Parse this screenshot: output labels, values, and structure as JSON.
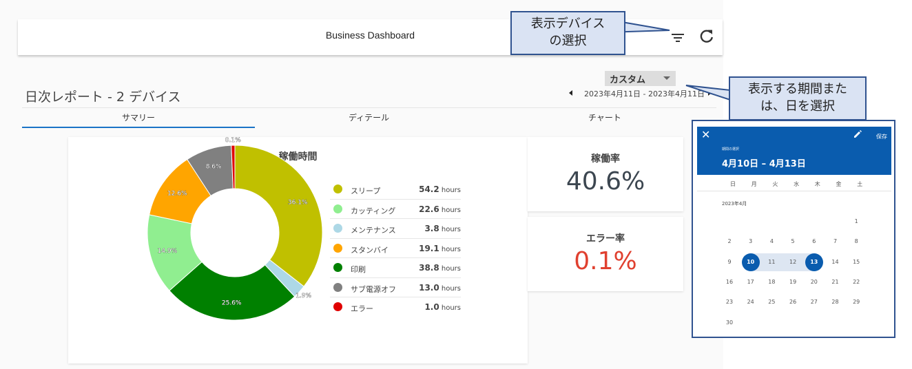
{
  "header": {
    "title": "Business Dashboard",
    "filter_icon": "filter-list-icon",
    "refresh_icon": "refresh-icon"
  },
  "report": {
    "title": "日次レポート - 2 デバイス",
    "range_mode": "カスタム",
    "date_range": "2023年4月11日 - 2023年4月11日"
  },
  "tabs": [
    {
      "label": "サマリー",
      "active": true
    },
    {
      "label": "ディテール",
      "active": false
    },
    {
      "label": "チャート",
      "active": false
    }
  ],
  "pie_card": {
    "title": "稼働時間",
    "unit": "hours"
  },
  "chart_data": {
    "type": "pie",
    "title": "稼働時間",
    "donut": true,
    "unit": "hours",
    "series": [
      {
        "name": "スリープ",
        "value": 54.2,
        "percent_label": "36.1%",
        "color": "#c0c000"
      },
      {
        "name": "カッティング",
        "value": 22.6,
        "percent_label": "14.9%",
        "color": "#90ee90"
      },
      {
        "name": "メンテナンス",
        "value": 3.8,
        "percent_label": "1.9%",
        "color": "#add8e6"
      },
      {
        "name": "スタンバイ",
        "value": 19.1,
        "percent_label": "12.6%",
        "color": "#ffa500"
      },
      {
        "name": "印刷",
        "value": 38.8,
        "percent_label": "25.6%",
        "color": "#008000"
      },
      {
        "name": "サブ電源オフ",
        "value": 13.0,
        "percent_label": "8.6%",
        "color": "#808080"
      },
      {
        "name": "エラー",
        "value": 1.0,
        "percent_label": "0.1%",
        "color": "#e00000"
      }
    ],
    "slice_order": [
      0,
      2,
      4,
      1,
      3,
      5,
      6
    ],
    "legend_position": "right"
  },
  "stats": {
    "uptime": {
      "label": "稼働率",
      "value": "40.6%",
      "color": "#3c4650"
    },
    "error": {
      "label": "エラー率",
      "value": "0.1%",
      "color": "#e0402f"
    }
  },
  "callouts": {
    "device": "表示デバイス\nの選択",
    "period": "表示する期間また\nは、日を選択"
  },
  "calendar": {
    "close_icon": "close-icon",
    "edit_icon": "pencil-icon",
    "save_label": "保存",
    "caption": "期間の選択",
    "range_label": "4月10日 – 4月13日",
    "weekdays": [
      "日",
      "月",
      "火",
      "水",
      "木",
      "金",
      "土"
    ],
    "month_label": "2023年4月",
    "days": [
      "1",
      "2",
      "3",
      "4",
      "5",
      "6",
      "7",
      "8",
      "9",
      "10",
      "11",
      "12",
      "13",
      "14",
      "15",
      "16",
      "17",
      "18",
      "19",
      "20",
      "21",
      "22",
      "23",
      "24",
      "25",
      "26",
      "27",
      "28",
      "29",
      "30"
    ],
    "first_weekday": 6,
    "selected_start": "10",
    "selected_end": "13"
  }
}
